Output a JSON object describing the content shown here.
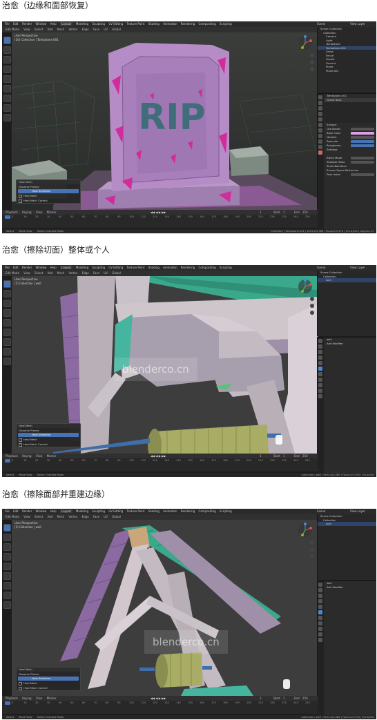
{
  "captions": {
    "c1": "治愈（边缘和面部恢复）",
    "c2": "治愈（擦除切面）整体或个人",
    "c3": "治愈（擦除面部并重建边缘）"
  },
  "menu": {
    "file": "File",
    "edit": "Edit",
    "render": "Render",
    "window": "Window",
    "help": "Help",
    "tabs": [
      "Layout",
      "Modeling",
      "Sculpting",
      "UV Editing",
      "Texture Paint",
      "Shading",
      "Animation",
      "Rendering",
      "Compositing",
      "Scripting"
    ],
    "scene": "Scene",
    "view_layer": "View Layer"
  },
  "viewport": {
    "mode": "Edit Mode",
    "view": "View",
    "select": "Select",
    "add": "Add",
    "mesh": "Mesh",
    "vertex": "Vertex",
    "edge": "Edge",
    "face": "Face",
    "uv": "UV",
    "orientation": "Global",
    "perspective": "User Perspective",
    "collection_1": "(10) Collection | Tombstone.001",
    "collection_2": "(1) Collection | well",
    "collection_3": "(1) Collection | well"
  },
  "scene1": {
    "rip_text": "RIP"
  },
  "redo_panel": {
    "title": "Heal Mesh",
    "row1": "Dissolve Planes",
    "selected": "Heal Selection",
    "row3": "Heal Mesh",
    "row4": "Heal Mesh Correct"
  },
  "watermark": "blenderco.cn",
  "timeline": {
    "playback": "Playback",
    "keying": "Keying",
    "view": "View",
    "marker": "Marker",
    "frame": "1",
    "start": "Start",
    "start_val": "1",
    "end": "End",
    "end_val": "250",
    "ticks": [
      "0",
      "10",
      "20",
      "30",
      "40",
      "50",
      "60",
      "70",
      "80",
      "90",
      "100",
      "110",
      "120",
      "130",
      "140",
      "150",
      "160",
      "170",
      "180",
      "190",
      "200",
      "210",
      "220",
      "230",
      "240",
      "250"
    ]
  },
  "status": {
    "select": "Select",
    "move": "Move View",
    "context": "Select Checked Mode",
    "stats1": "Collection | Tombstone.001 | Verts:0/3,364 | Faces:0/3,378 | Tris:6,620 | Objects:1/7",
    "stats2": "Collection | well | Verts:0/3,086 | Faces:0/2,994 | Tris:6,084",
    "stats3": "Collection | well | Verts:0/3,086 | Faces:0/2,994 | Tris:6,084"
  },
  "outliner1": {
    "rows": [
      "Scene Collection",
      "Collection",
      "Camera",
      "Light",
      "Tombstone",
      "Tombstone.001",
      "Grass",
      "Fence",
      "Gravel",
      "Ground",
      "Plane",
      "Plane.001"
    ]
  },
  "outliner2": {
    "rows": [
      "Scene Collection",
      "Collection",
      "well"
    ]
  },
  "outliner3": {
    "rows": [
      "Scene Collection",
      "Collection",
      "well"
    ]
  },
  "props1": {
    "object": "Tombstone.001",
    "material": "Grave Rock",
    "material_slot": "Surface",
    "use_nodes": "Use Nodes",
    "base_color": "Base Color",
    "metallic": "Metallic",
    "specular": "Specular",
    "roughness": "Roughness",
    "settings": "Settings",
    "blend_mode": "Blend Mode",
    "blend_val": "Opaque",
    "shadow_mode": "Shadow Mode",
    "shadow_val": "Opaque",
    "backface": "Show Backface",
    "refraction": "Screen Space Refraction",
    "pass_index": "Pass Index"
  },
  "props2": {
    "object": "well",
    "label": "Add Modifier"
  },
  "props3": {
    "object": "well",
    "label": "Add Modifier"
  }
}
